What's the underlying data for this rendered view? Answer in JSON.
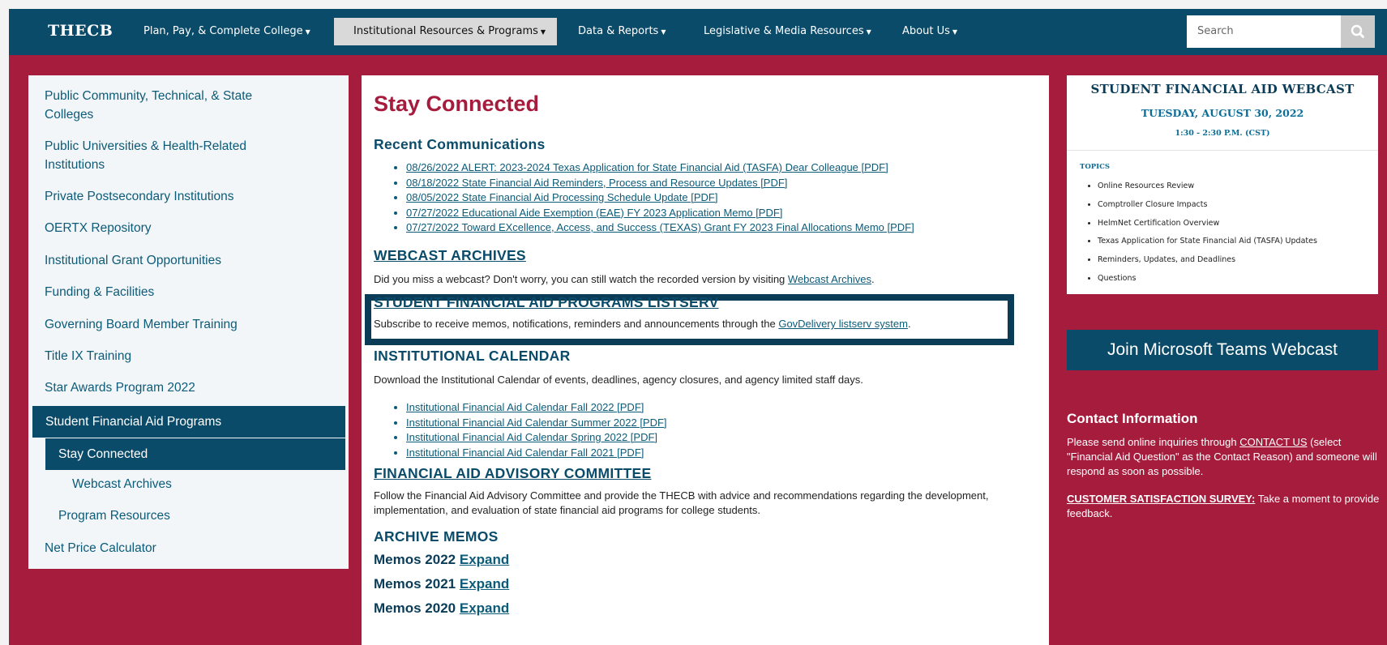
{
  "nav": {
    "logo": "THECB",
    "items": [
      {
        "label": "Plan, Pay, & Complete College"
      },
      {
        "label": "Institutional Resources & Programs"
      },
      {
        "label": "Data & Reports"
      },
      {
        "label": "Legislative & Media Resources"
      },
      {
        "label": "About Us"
      }
    ],
    "search_placeholder": "Search"
  },
  "sidebar": {
    "items": [
      {
        "label": "Public Community, Technical, & State Colleges"
      },
      {
        "label": "Public Universities & Health-Related Institutions"
      },
      {
        "label": "Private Postsecondary Institutions"
      },
      {
        "label": "OERTX Repository"
      },
      {
        "label": "Institutional Grant Opportunities"
      },
      {
        "label": "Funding & Facilities"
      },
      {
        "label": "Governing Board Member Training"
      },
      {
        "label": "Title IX Training"
      },
      {
        "label": "Star Awards Program 2022"
      },
      {
        "label": "Student Financial Aid Programs"
      },
      {
        "label": "Stay Connected"
      },
      {
        "label": "Webcast Archives"
      },
      {
        "label": "Program Resources"
      },
      {
        "label": "Net Price Calculator"
      }
    ]
  },
  "main": {
    "title": "Stay Connected",
    "recent": {
      "heading": "Recent Communications",
      "links": [
        "08/26/2022 ALERT: 2023-2024 Texas Application for State Financial Aid (TASFA) Dear Colleague [PDF]",
        "08/18/2022 State Financial Aid Reminders, Process and Resource Updates [PDF]",
        "08/05/2022 State Financial Aid Processing Schedule Update [PDF]",
        "07/27/2022 Educational Aide Exemption (EAE) FY 2023 Application Memo [PDF]",
        "07/27/2022 Toward EXcellence, Access, and Success (TEXAS) Grant FY 2023 Final Allocations Memo [PDF]"
      ]
    },
    "webcast": {
      "heading": "WEBCAST ARCHIVES",
      "text": "Did you miss a webcast? Don't worry, you can still watch the recorded version by visiting ",
      "link": "Webcast Archives",
      "end": "."
    },
    "listserv": {
      "heading": "STUDENT FINANCIAL AID PROGRAMS LISTSERV",
      "text": "Subscribe to receive memos, notifications, reminders and announcements through the ",
      "link": "GovDelivery listserv system",
      "end": "."
    },
    "calendar": {
      "heading": "INSTITUTIONAL CALENDAR",
      "text": "Download the Institutional Calendar of events, deadlines, agency closures, and agency limited staff days.",
      "links": [
        "Institutional Financial Aid Calendar Fall 2022 [PDF]",
        "Institutional Financial Aid Calendar Summer 2022 [PDF]",
        "Institutional Financial Aid Calendar Spring 2022 [PDF]",
        "Institutional Financial Aid Calendar Fall 2021 [PDF]"
      ]
    },
    "advisory": {
      "heading": "FINANCIAL AID ADVISORY COMMITTEE",
      "text": "Follow the Financial Aid Advisory Committee and provide the THECB with advice and recommendations regarding the development, implementation, and evaluation of state financial aid programs for college students."
    },
    "archive": {
      "heading": "ARCHIVE MEMOS",
      "expand_label": "Expand",
      "memos": [
        "Memos 2022",
        "Memos 2021",
        "Memos 2020"
      ]
    }
  },
  "webcast_card": {
    "title": "STUDENT FINANCIAL AID WEBCAST",
    "date": "TUESDAY, AUGUST 30, 2022",
    "time": "1:30 - 2:30 P.M. (CST)",
    "topics_label": "TOPICS",
    "topics": [
      "Online Resources Review",
      "Comptroller Closure Impacts",
      "HelmNet Certification Overview",
      "Texas Application for State Financial Aid (TASFA) Updates",
      "Reminders, Updates, and Deadlines",
      "Questions"
    ]
  },
  "teams_button": "Join Microsoft Teams Webcast",
  "contact": {
    "title": "Contact Information",
    "p1_pre": "Please send online inquiries through ",
    "p1_link": "CONTACT US",
    "p1_post": " (select \"Financial Aid Question\" as the Contact Reason) and someone will respond as soon as possible.",
    "p2_link": "CUSTOMER SATISFACTION SURVEY:",
    "p2_post": " Take a moment to provide feedback."
  },
  "colors": {
    "brand_red": "#a51c3d",
    "brand_blue": "#0a4b6a",
    "link_blue": "#0c5b79"
  }
}
